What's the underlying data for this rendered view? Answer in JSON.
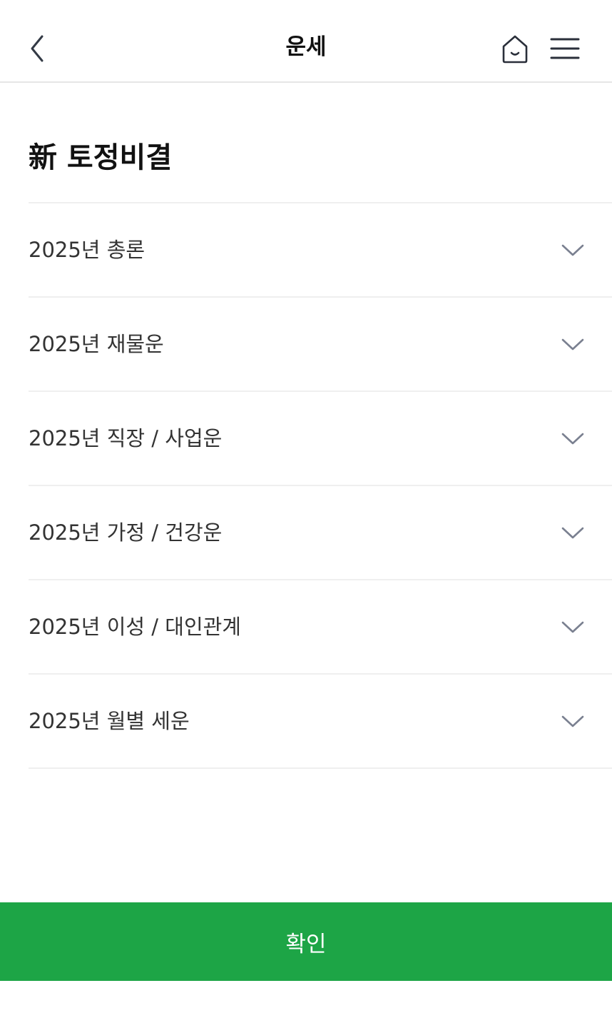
{
  "header": {
    "title": "운세",
    "back_icon": "chevron-left-icon",
    "home_icon": "home-icon",
    "menu_icon": "hamburger-menu-icon"
  },
  "page": {
    "title": "新 토정비결"
  },
  "sections": [
    {
      "label": "2025년 총론",
      "expanded": false
    },
    {
      "label": "2025년 재물운",
      "expanded": false
    },
    {
      "label": "2025년 직장 / 사업운",
      "expanded": false
    },
    {
      "label": "2025년 가정 / 건강운",
      "expanded": false
    },
    {
      "label": "2025년 이성 / 대인관계",
      "expanded": false
    },
    {
      "label": "2025년 월별 세운",
      "expanded": false
    }
  ],
  "footer": {
    "confirm_label": "확인"
  },
  "colors": {
    "accent": "#1da546",
    "divider": "#efefef",
    "chevron": "#7a8090"
  }
}
